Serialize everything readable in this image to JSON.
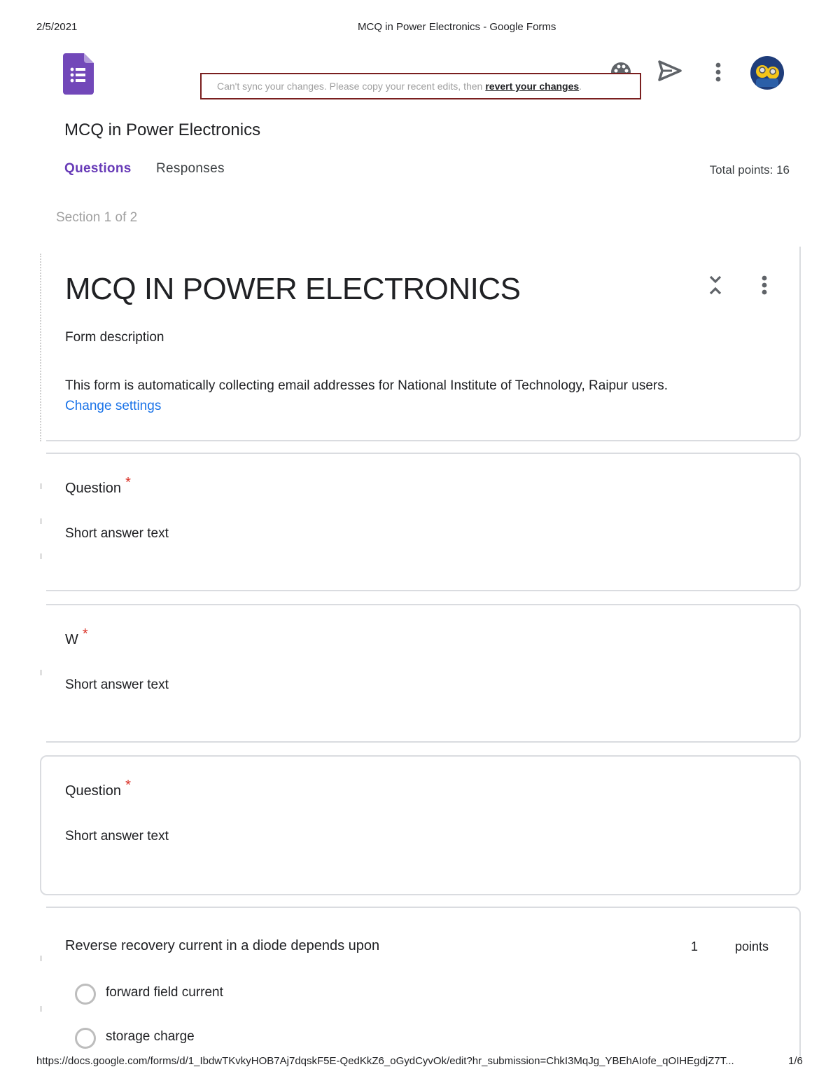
{
  "print_header": {
    "date": "2/5/2021",
    "page_title": "MCQ in Power Electronics - Google Forms"
  },
  "print_footer": {
    "url": "https://docs.google.com/forms/d/1_IbdwTKvkyHOB7Aj7dqskF5E-QedKkZ6_oGydCyvOk/edit?hr_submission=ChkI3MqJg_YBEhAIofe_qOIHEgdjZ7T...",
    "page": "1/6"
  },
  "toolbar": {
    "sync_message": "Can't sync your changes. Please copy your recent edits, then",
    "sync_link": "revert your changes",
    "sync_end": ".",
    "icons": [
      "forms-logo-icon",
      "palette-icon",
      "send-icon",
      "more-vert-icon",
      "avatar"
    ]
  },
  "form": {
    "title": "MCQ in Power Electronics",
    "tabs": [
      "Questions",
      "Responses"
    ],
    "active_tab": "Questions",
    "total_points": "Total points: 16",
    "section_label": "Section 1 of 2"
  },
  "header_card": {
    "title": "MCQ IN POWER ELECTRONICS",
    "description": "Form description",
    "notice": "This form is automatically collecting email addresses for National Institute of Technology, Raipur users.",
    "notice_link": "Change settings"
  },
  "questions": [
    {
      "title": "Question",
      "required": "*",
      "placeholder": "Short answer text"
    },
    {
      "title": "W",
      "required": "*",
      "placeholder": "Short answer text"
    },
    {
      "title": "Question",
      "required": "*",
      "placeholder": "Short answer text"
    }
  ],
  "mcq": {
    "title": "Reverse recovery current in a diode depends upon",
    "points_value": "1",
    "points_label": "points",
    "options": [
      "forward field current",
      "storage charge"
    ]
  },
  "colors": {
    "accent": "#673ab7",
    "required": "#d93025",
    "link": "#1a73e8",
    "sync_border": "#7a1f1f"
  }
}
